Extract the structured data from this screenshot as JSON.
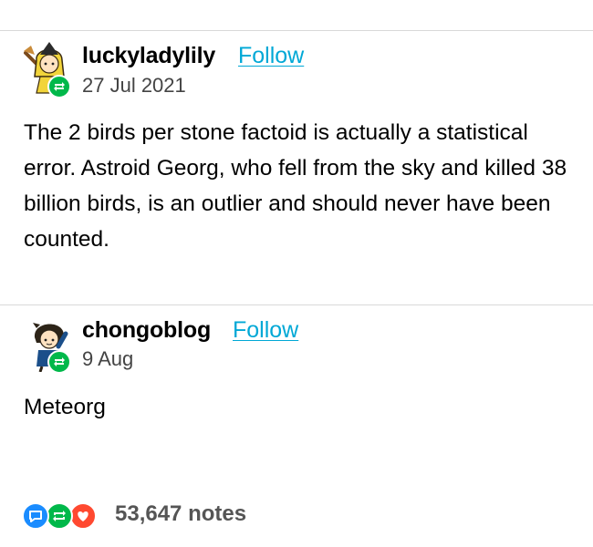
{
  "posts": [
    {
      "username": "luckyladylily",
      "follow_label": "Follow",
      "date": "27 Jul 2021",
      "avatar_icon": "yellow-haired-character-avatar",
      "badge_icon": "reblog-icon",
      "body": "The 2 birds per stone factoid is actually a statistical error. Astroid Georg, who fell from the sky and killed 38 billion birds, is an outlier and should never have been counted."
    },
    {
      "username": "chongoblog",
      "follow_label": "Follow",
      "date": "9 Aug",
      "avatar_icon": "dark-haired-character-avatar",
      "badge_icon": "reblog-icon",
      "body": "Meteorg"
    }
  ],
  "notes": {
    "count_text": "53,647 notes",
    "icons": [
      "comment-icon",
      "reblog-icon",
      "heart-icon"
    ],
    "colors": {
      "comment": "#1a8cff",
      "reblog": "#00b84a",
      "heart": "#ff4930"
    }
  },
  "colors": {
    "follow_link": "#00a8d6",
    "divider": "#d9d9d9"
  }
}
